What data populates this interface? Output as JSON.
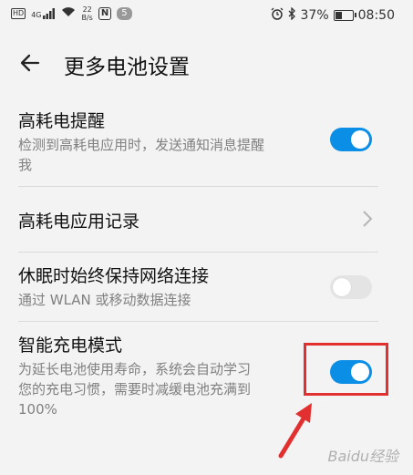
{
  "status_bar": {
    "hd": "HD",
    "signal": "4G",
    "net_speed_value": "22",
    "net_speed_unit": "B/s",
    "nfc": "N",
    "notification_count": "5",
    "battery_percent": "37%",
    "battery_level": 0.37,
    "time": "08:50"
  },
  "header": {
    "title": "更多电池设置"
  },
  "settings": [
    {
      "title": "高耗电提醒",
      "desc_lines": [
        "检测到高耗电应用时，发送通知消息提醒",
        "我"
      ],
      "control": "toggle",
      "state": "on"
    },
    {
      "title": "高耗电应用记录",
      "control": "chevron"
    },
    {
      "title": "休眠时始终保持网络连接",
      "desc_lines": [
        "通过 WLAN 或移动数据连接"
      ],
      "control": "toggle",
      "state": "off"
    },
    {
      "title": "智能充电模式",
      "desc_lines": [
        "为延长电池使用寿命，系统会自动学习",
        "您的充电习惯，需要时减缓电池充满到",
        "100%"
      ],
      "control": "toggle",
      "state": "on"
    }
  ],
  "watermark": "Baidu经验",
  "colors": {
    "toggle_on": "#0a8ee6",
    "toggle_off": "#e4e4e4",
    "highlight": "#e23030",
    "background": "#f3f3f3"
  }
}
